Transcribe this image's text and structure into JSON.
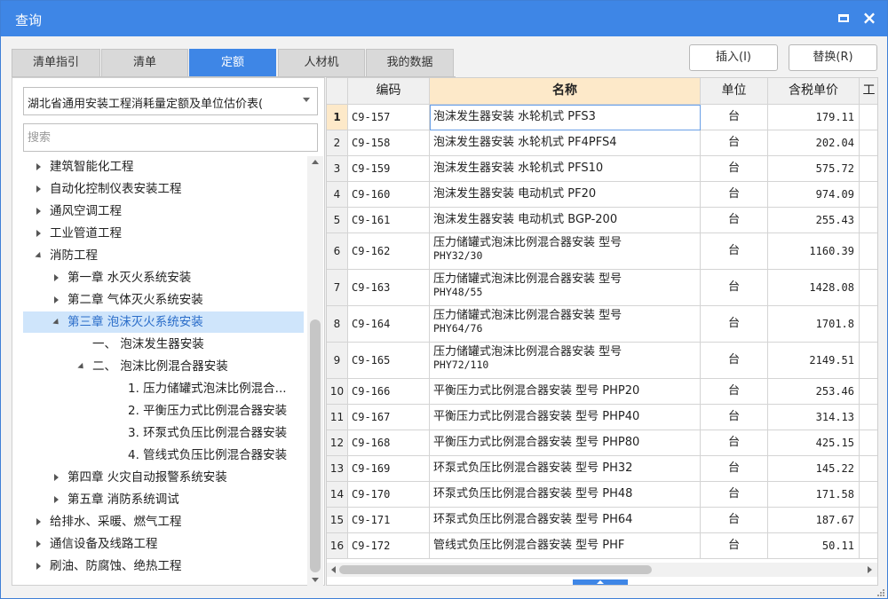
{
  "window": {
    "title": "查询",
    "minimize_icon": "minimize-icon",
    "close_label": "×"
  },
  "tabs": [
    {
      "label": "清单指引"
    },
    {
      "label": "清单"
    },
    {
      "label": "定额"
    },
    {
      "label": "人材机"
    },
    {
      "label": "我的数据"
    }
  ],
  "active_tab": "定额",
  "actions": {
    "insert_label": "插入(I)",
    "replace_label": "替换(R)"
  },
  "left": {
    "library_select": "湖北省通用安装工程消耗量定额及单位估价表(",
    "search_placeholder": "搜索",
    "tree": [
      {
        "label": "建筑智能化工程",
        "level": 0,
        "state": "collapsed"
      },
      {
        "label": "自动化控制仪表安装工程",
        "level": 0,
        "state": "collapsed"
      },
      {
        "label": "通风空调工程",
        "level": 0,
        "state": "collapsed"
      },
      {
        "label": "工业管道工程",
        "level": 0,
        "state": "collapsed"
      },
      {
        "label": "消防工程",
        "level": 0,
        "state": "expanded"
      },
      {
        "label": "第一章 水灭火系统安装",
        "level": 1,
        "state": "collapsed"
      },
      {
        "label": "第二章 气体灭火系统安装",
        "level": 1,
        "state": "collapsed"
      },
      {
        "label": "第三章 泡沫灭火系统安装",
        "level": 1,
        "state": "expanded",
        "selected": true
      },
      {
        "label": "一、 泡沫发生器安装",
        "level": 2,
        "state": "leaf"
      },
      {
        "label": "二、 泡沫比例混合器安装",
        "level": 2,
        "state": "expanded"
      },
      {
        "label": "1. 压力储罐式泡沫比例混合...",
        "level": 3,
        "state": "leaf"
      },
      {
        "label": "2. 平衡压力式比例混合器安装",
        "level": 3,
        "state": "leaf"
      },
      {
        "label": "3. 环泵式负压比例混合器安装",
        "level": 3,
        "state": "leaf"
      },
      {
        "label": "4. 管线式负压比例混合器安装",
        "level": 3,
        "state": "leaf"
      },
      {
        "label": "第四章 火灾自动报警系统安装",
        "level": 1,
        "state": "collapsed"
      },
      {
        "label": "第五章 消防系统调试",
        "level": 1,
        "state": "collapsed"
      },
      {
        "label": "给排水、采暖、燃气工程",
        "level": 0,
        "state": "collapsed"
      },
      {
        "label": "通信设备及线路工程",
        "level": 0,
        "state": "collapsed"
      },
      {
        "label": "刷油、防腐蚀、绝热工程",
        "level": 0,
        "state": "collapsed"
      }
    ]
  },
  "grid": {
    "columns": [
      "",
      "编码",
      "名称",
      "单位",
      "含税单价",
      "工"
    ],
    "rows": [
      {
        "idx": "1",
        "code": "C9-157",
        "name": "泡沫发生器安装 水轮机式 PFS3",
        "unit": "台",
        "price": "179.11"
      },
      {
        "idx": "2",
        "code": "C9-158",
        "name": "泡沫发生器安装 水轮机式 PF4PFS4",
        "unit": "台",
        "price": "202.04"
      },
      {
        "idx": "3",
        "code": "C9-159",
        "name": "泡沫发生器安装 水轮机式 PFS10",
        "unit": "台",
        "price": "575.72"
      },
      {
        "idx": "4",
        "code": "C9-160",
        "name": "泡沫发生器安装 电动机式 PF20",
        "unit": "台",
        "price": "974.09"
      },
      {
        "idx": "5",
        "code": "C9-161",
        "name": "泡沫发生器安装 电动机式 BGP-200",
        "unit": "台",
        "price": "255.43"
      },
      {
        "idx": "6",
        "code": "C9-162",
        "name": "压力储罐式泡沫比例混合器安装 型号",
        "name2": "PHY32/30",
        "unit": "台",
        "price": "1160.39"
      },
      {
        "idx": "7",
        "code": "C9-163",
        "name": "压力储罐式泡沫比例混合器安装 型号",
        "name2": "PHY48/55",
        "unit": "台",
        "price": "1428.08"
      },
      {
        "idx": "8",
        "code": "C9-164",
        "name": "压力储罐式泡沫比例混合器安装 型号",
        "name2": "PHY64/76",
        "unit": "台",
        "price": "1701.8"
      },
      {
        "idx": "9",
        "code": "C9-165",
        "name": "压力储罐式泡沫比例混合器安装 型号",
        "name2": "PHY72/110",
        "unit": "台",
        "price": "2149.51"
      },
      {
        "idx": "10",
        "code": "C9-166",
        "name": "平衡压力式比例混合器安装 型号 PHP20",
        "unit": "台",
        "price": "253.46"
      },
      {
        "idx": "11",
        "code": "C9-167",
        "name": "平衡压力式比例混合器安装 型号 PHP40",
        "unit": "台",
        "price": "314.13"
      },
      {
        "idx": "12",
        "code": "C9-168",
        "name": "平衡压力式比例混合器安装 型号 PHP80",
        "unit": "台",
        "price": "425.15"
      },
      {
        "idx": "13",
        "code": "C9-169",
        "name": "环泵式负压比例混合器安装 型号 PH32",
        "unit": "台",
        "price": "145.22"
      },
      {
        "idx": "14",
        "code": "C9-170",
        "name": "环泵式负压比例混合器安装 型号 PH48",
        "unit": "台",
        "price": "171.58"
      },
      {
        "idx": "15",
        "code": "C9-171",
        "name": "环泵式负压比例混合器安装 型号 PH64",
        "unit": "台",
        "price": "187.67"
      },
      {
        "idx": "16",
        "code": "C9-172",
        "name": "管线式负压比例混合器安装 型号 PHF",
        "unit": "台",
        "price": "50.11"
      }
    ]
  },
  "colors": {
    "accent": "#3e86e6",
    "header_highlight": "#fde9c9",
    "selection": "#cfe5fb"
  }
}
